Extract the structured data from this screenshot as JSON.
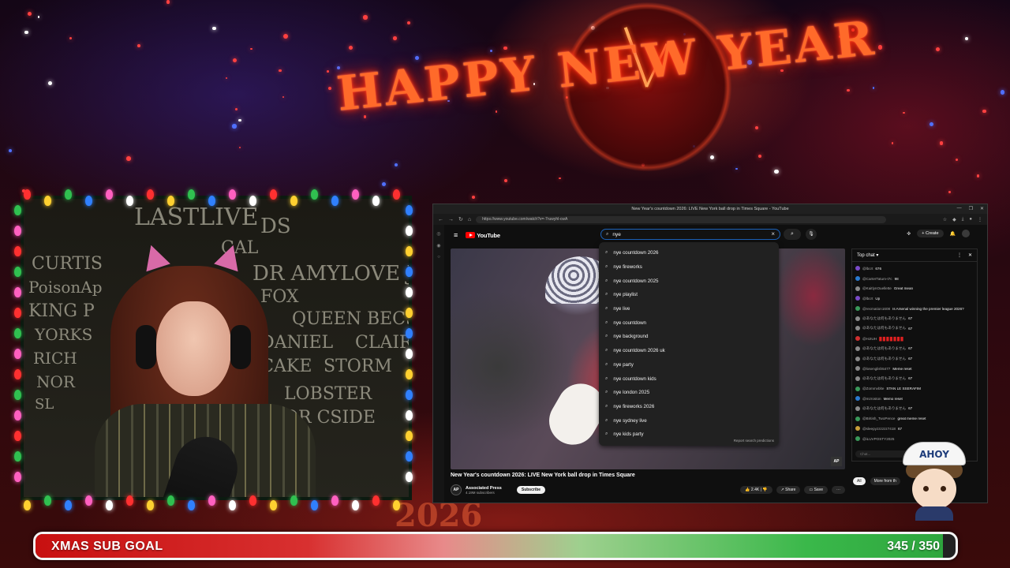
{
  "overlay": {
    "banner_text": "HAPPY NEW YEAR",
    "year_text": "2026",
    "goal": {
      "label": "XMAS SUB GOAL",
      "count_text": "345 / 350",
      "progress": 0.986
    },
    "mascot_hat_text": "AHOY"
  },
  "webcam": {
    "chalk_words": [
      "CURTIS",
      "PoisonAp",
      "KING P",
      "YORKS",
      "RICH",
      "NOR",
      "SL",
      "CAL",
      "DR AMYLOVE JOSH",
      "FOX",
      "QUEEN BECS",
      "DANIEL",
      "CLAIRE",
      "CUPCAKE",
      "STORM",
      "LOBSTER",
      "OR CSIDE",
      "LASTLIVE",
      "DS"
    ]
  },
  "browser": {
    "window_title": "New Year's countdown 2026: LIVE New York ball drop in Times Square - YouTube",
    "url": "https://www.youtube.com/watch?v=-7ruwyhl-cwA",
    "window_controls": [
      "—",
      "❐",
      "✕"
    ]
  },
  "youtube": {
    "logo_text": "YouTube",
    "search_value": "nye",
    "create_label": "Create",
    "suggestions": [
      "nye countdown 2026",
      "nye fireworks",
      "nye countdown 2025",
      "nye playlist",
      "nye live",
      "nye countdown",
      "nye background",
      "nye countdown 2026 uk",
      "nye party",
      "nye countdown kids",
      "nye london 2025",
      "nye fireworks 2026",
      "nye sydney live",
      "nye kids party"
    ],
    "report_text": "Report search predictions",
    "video_title": "New Year's countdown 2026: LIVE New York ball drop in Times Square",
    "channel_name": "Associated Press",
    "channel_subs": "4.19M subscribers",
    "channel_avatar_text": "AP",
    "subscribe_label": "Subscribe",
    "like_count": "2.4K",
    "share_label": "Share",
    "save_label": "Save",
    "video_badge": "AP"
  },
  "chat": {
    "header": "Top chat",
    "input_placeholder": "Chat...",
    "tabs": [
      "All",
      "More from th"
    ],
    "messages": [
      {
        "user": "@lbcrt",
        "text": "676",
        "color": "#7a4ac8"
      },
      {
        "user": "@CarterTatum-t7c",
        "text": "98",
        "color": "#2a7ad0"
      },
      {
        "user": "@KaitlynOuellette",
        "text": "Great mean",
        "color": "#8a8a8a"
      },
      {
        "user": "@lbcrt",
        "text": "Up",
        "color": "#7a4ac8"
      },
      {
        "user": "@recmation1608",
        "text": "Is Arsenal winning the premier league 2026?",
        "color": "#3a9a5a"
      },
      {
        "user": "@あなたは何もありません",
        "text": "67",
        "color": "#8a8a8a"
      },
      {
        "user": "@あなたは何もありません",
        "text": "67",
        "color": "#8a8a8a"
      },
      {
        "user": "@HJIUH",
        "text": "█ █ █ █ █ █ █",
        "color": "#d03030"
      },
      {
        "user": "@あなたは何もありません",
        "text": "67",
        "color": "#8a8a8a"
      },
      {
        "user": "@あなたは何もありません",
        "text": "67",
        "color": "#8a8a8a"
      },
      {
        "user": "@losenglish5477",
        "text": "Meme reset",
        "color": "#8a8a8a"
      },
      {
        "user": "@あなたは何もありません",
        "text": "67",
        "color": "#8a8a8a"
      },
      {
        "user": "@Zommvblte",
        "text": "STAN LE SSERAFIM",
        "color": "#3a9a5a"
      },
      {
        "user": "@mzroston",
        "text": "Memo reset",
        "color": "#2a7ad0"
      },
      {
        "user": "@あなたは何もありません",
        "text": "67",
        "color": "#8a8a8a"
      },
      {
        "user": "@British_TwoPence",
        "text": "great meme reset",
        "color": "#3a9a5a"
      },
      {
        "user": "@sleepyzzzzzz7418",
        "text": "67",
        "color": "#c8a03a"
      },
      {
        "user": "@iLUVPOSTY2025",
        "text": "",
        "color": "#3a9a5a"
      }
    ]
  }
}
